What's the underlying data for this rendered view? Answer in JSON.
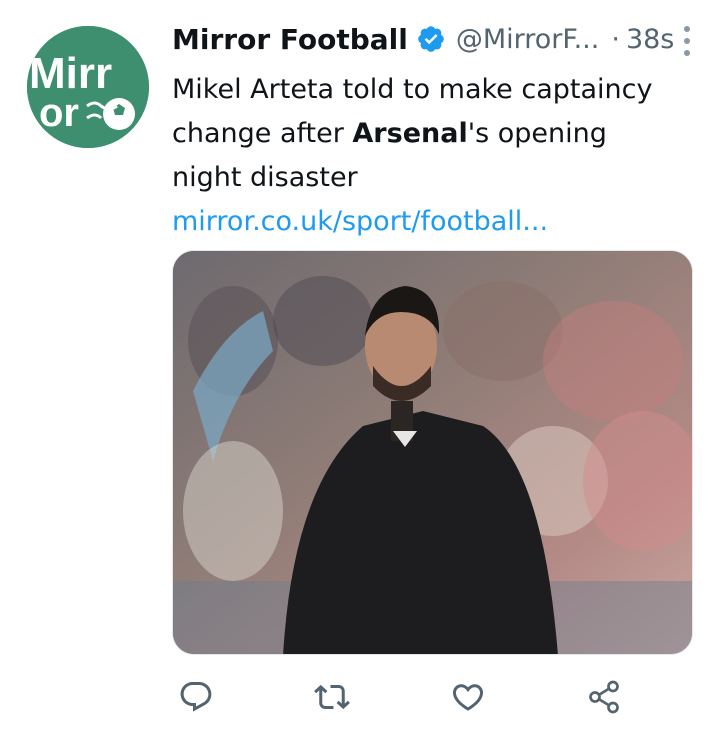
{
  "tweet": {
    "display_name": "Mirror Football",
    "handle": "@MirrorF...",
    "separator": "·",
    "time": "38s",
    "text_part1": "Mikel Arteta told to make captaincy change after ",
    "text_bold": "Arsenal",
    "text_part2": "'s opening night disaster",
    "link": "mirror.co.uk/sport/football...",
    "avatar_text_top": "Mirr",
    "avatar_text_bottom": "or",
    "media_alt": "Mikel Arteta standing on the sideline in front of a crowd"
  },
  "colors": {
    "brand": "#3e8f70",
    "verified": "#1d9bf0",
    "link": "#1d9bf0",
    "muted": "#536471"
  },
  "icons": {
    "reply": "reply-icon",
    "retweet": "retweet-icon",
    "like": "like-icon",
    "share": "share-icon",
    "verified": "verified-badge-icon",
    "more": "more-options-icon"
  }
}
